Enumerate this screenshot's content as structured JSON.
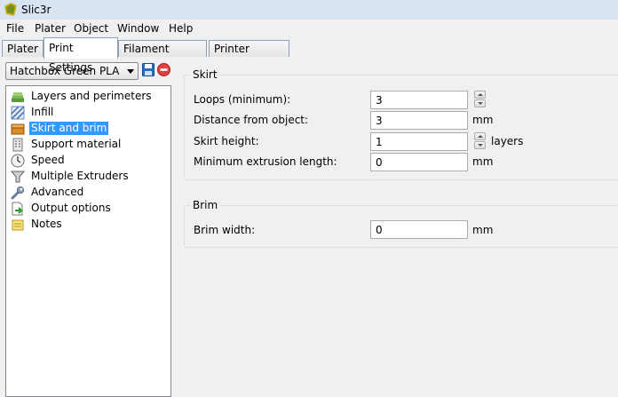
{
  "window": {
    "title": "Slic3r"
  },
  "menu": [
    "File",
    "Plater",
    "Object",
    "Window",
    "Help"
  ],
  "tabs": [
    {
      "label": "Plater"
    },
    {
      "label": "Print Settings",
      "active": true
    },
    {
      "label": "Filament Settings"
    },
    {
      "label": "Printer Settings"
    }
  ],
  "preset": {
    "selected": "Hatchbox Green PLA"
  },
  "sidebar": {
    "items": [
      {
        "label": "Layers and perimeters",
        "icon": "layers-icon"
      },
      {
        "label": "Infill",
        "icon": "infill-icon"
      },
      {
        "label": "Skirt and brim",
        "icon": "box-icon",
        "selected": true
      },
      {
        "label": "Support material",
        "icon": "building-icon"
      },
      {
        "label": "Speed",
        "icon": "clock-icon"
      },
      {
        "label": "Multiple Extruders",
        "icon": "funnel-icon"
      },
      {
        "label": "Advanced",
        "icon": "wrench-icon"
      },
      {
        "label": "Output options",
        "icon": "page-export-icon"
      },
      {
        "label": "Notes",
        "icon": "note-icon"
      }
    ]
  },
  "skirt": {
    "title": "Skirt",
    "fields": [
      {
        "label": "Loops (minimum):",
        "value": "3",
        "unit": ""
      },
      {
        "label": "Distance from object:",
        "value": "3",
        "unit": "mm"
      },
      {
        "label": "Skirt height:",
        "value": "1",
        "unit": "layers"
      },
      {
        "label": "Minimum extrusion length:",
        "value": "0",
        "unit": "mm"
      }
    ]
  },
  "brim": {
    "title": "Brim",
    "fields": [
      {
        "label": "Brim width:",
        "value": "0",
        "unit": "mm"
      }
    ]
  },
  "colors": {
    "selection": "#3399ff",
    "panel": "#f0f0f0"
  }
}
